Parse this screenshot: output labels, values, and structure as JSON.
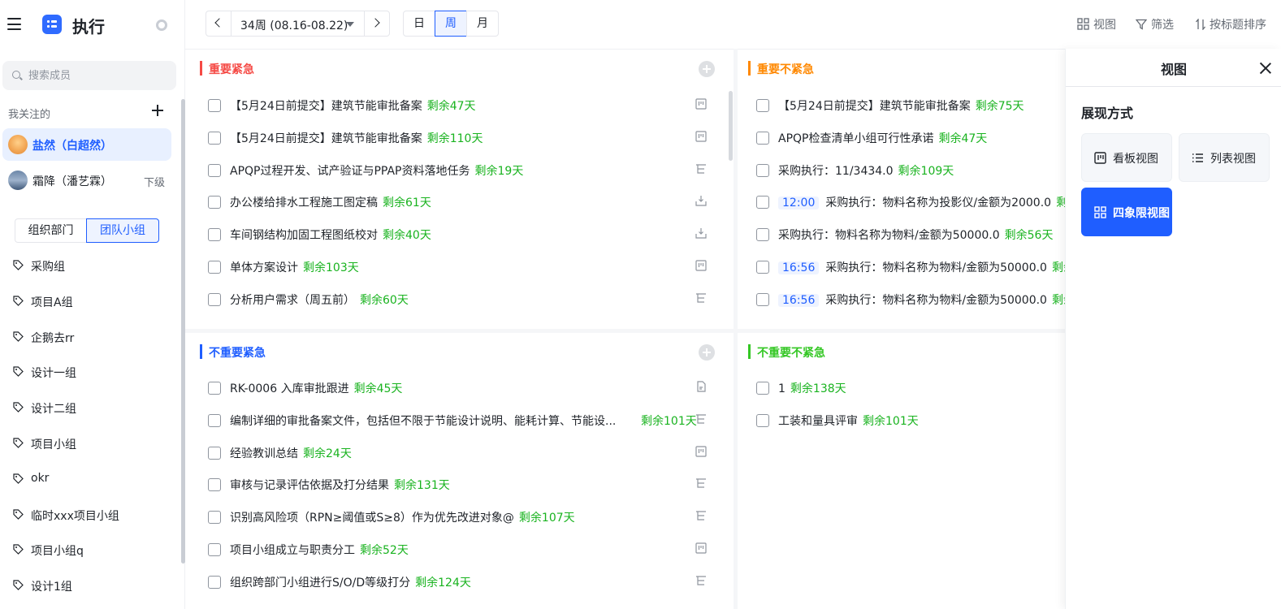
{
  "app": {
    "title": "执行"
  },
  "sidebar": {
    "search_placeholder": "搜索成员",
    "following_label": "我关注的",
    "people": [
      {
        "name": "盐然（白超然）",
        "selected": true,
        "sub": ""
      },
      {
        "name": "霜降（潘艺霖）",
        "selected": false,
        "sub": "下级"
      }
    ],
    "segments": [
      "组织部门",
      "团队小组"
    ],
    "active_segment": "团队小组",
    "groups": [
      "采购组",
      "项目A组",
      "企鹅去rr",
      "设计一组",
      "设计二组",
      "项目小组",
      "okr",
      "临时xxx项目小组",
      "项目小组q",
      "设计1组"
    ]
  },
  "toolbar": {
    "week_label": "34周 (08.16-08.22)",
    "modes": [
      "日",
      "周",
      "月"
    ],
    "active_mode": "周",
    "view_label": "视图",
    "filter_label": "筛选",
    "sort_label": "按标题排序"
  },
  "quadrants": {
    "q1": {
      "title": "重要紧急",
      "color": "#f54a45",
      "tasks": [
        {
          "text": "【5月24日前提交】建筑节能审批备案",
          "time": "",
          "remaining": "剩余47天",
          "icon": "kanban-icon"
        },
        {
          "text": "【5月24日前提交】建筑节能审批备案",
          "time": "",
          "remaining": "剩余110天",
          "icon": "kanban-icon"
        },
        {
          "text": "APQP过程开发、试产验证与PPAP资料落地任务",
          "time": "",
          "remaining": "剩余19天",
          "icon": "subtask-icon"
        },
        {
          "text": "办公楼给排水工程施工图定稿",
          "time": "",
          "remaining": "剩余61天",
          "icon": "inbox-icon"
        },
        {
          "text": "车间钢结构加固工程图纸校对",
          "time": "",
          "remaining": "剩余40天",
          "icon": "inbox-icon"
        },
        {
          "text": "单体方案设计",
          "time": "",
          "remaining": "剩余103天",
          "icon": "kanban-icon"
        },
        {
          "text": "分析用户需求（周五前）",
          "time": "",
          "remaining": "剩余60天",
          "icon": "subtask-icon"
        }
      ]
    },
    "q2": {
      "title": "重要不紧急",
      "color": "#ff8800",
      "tasks": [
        {
          "text": "【5月24日前提交】建筑节能审批备案",
          "time": "",
          "remaining": "剩余75天"
        },
        {
          "text": "APQP检查清单小组可行性承诺",
          "time": "",
          "remaining": "剩余47天"
        },
        {
          "text": "采购执行：11/3434.0",
          "time": "",
          "remaining": "剩余109天"
        },
        {
          "text": "采购执行：物料名称为投影仪/金额为2000.0",
          "time": "12:00",
          "remaining": "剩余"
        },
        {
          "text": "采购执行：物料名称为物料/金额为50000.0",
          "time": "",
          "remaining": "剩余56天"
        },
        {
          "text": "采购执行：物料名称为物料/金额为50000.0",
          "time": "16:56",
          "remaining": "剩余"
        },
        {
          "text": "采购执行：物料名称为物料/金额为50000.0",
          "time": "16:56",
          "remaining": "剩余"
        }
      ]
    },
    "q3": {
      "title": "不重要紧急",
      "color": "#1f5eff",
      "tasks": [
        {
          "text": "RK-0006 入库审批跟进",
          "remaining": "剩余45天",
          "icon": "doc-icon"
        },
        {
          "text": "编制详细的审批备案文件，包括但不限于节能设计说明、能耗计算、节能设...",
          "remaining": "剩余101天",
          "icon": "subtask-icon"
        },
        {
          "text": "经验教训总结",
          "remaining": "剩余24天",
          "icon": "kanban-icon"
        },
        {
          "text": "审核与记录评估依据及打分结果",
          "remaining": "剩余131天",
          "icon": "subtask-icon"
        },
        {
          "text": "识别高风险项（RPN≥阈值或S≥8）作为优先改进对象@",
          "remaining": "剩余107天",
          "icon": "subtask-icon"
        },
        {
          "text": "项目小组成立与职责分工",
          "remaining": "剩余52天",
          "icon": "kanban-icon"
        },
        {
          "text": "组织跨部门小组进行S/O/D等级打分",
          "remaining": "剩余124天",
          "icon": "subtask-icon"
        }
      ]
    },
    "q4": {
      "title": "不重要不紧急",
      "color": "#34c724",
      "tasks": [
        {
          "text": "1",
          "remaining": "剩余138天"
        },
        {
          "text": "工装和量具评审",
          "remaining": "剩余101天"
        }
      ]
    }
  },
  "view_panel": {
    "title": "视图",
    "section_label": "展现方式",
    "options": [
      "看板视图",
      "列表视图",
      "四象限视图"
    ],
    "active": "四象限视图"
  }
}
